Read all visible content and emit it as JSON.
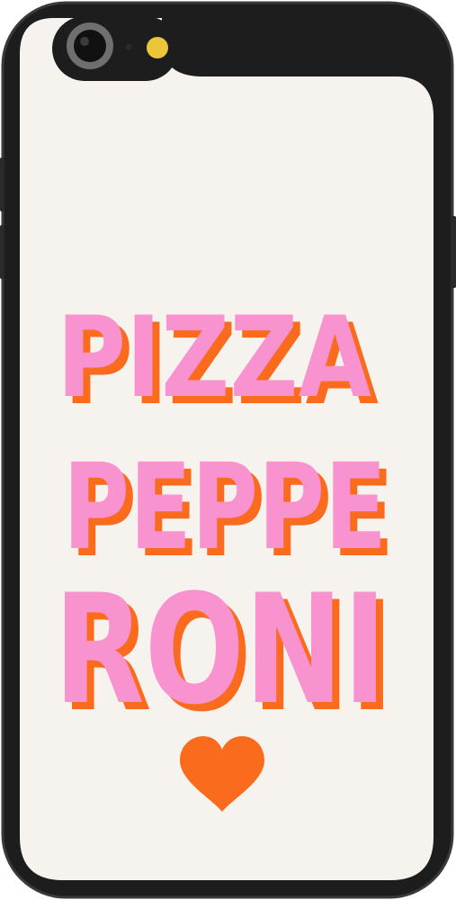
{
  "artwork": {
    "lines": [
      "PIZZA",
      "PEPPE",
      "RONI"
    ],
    "heart_icon": "heart-icon"
  },
  "colors": {
    "case_frame": "#1d1d1d",
    "case_edge": "#3a3a3a",
    "background": "#f6f3ef",
    "text_fill": "#f893cf",
    "text_shadow": "#fb6b1e",
    "heart": "#fb6b1e",
    "flash": "#e9c63a"
  }
}
